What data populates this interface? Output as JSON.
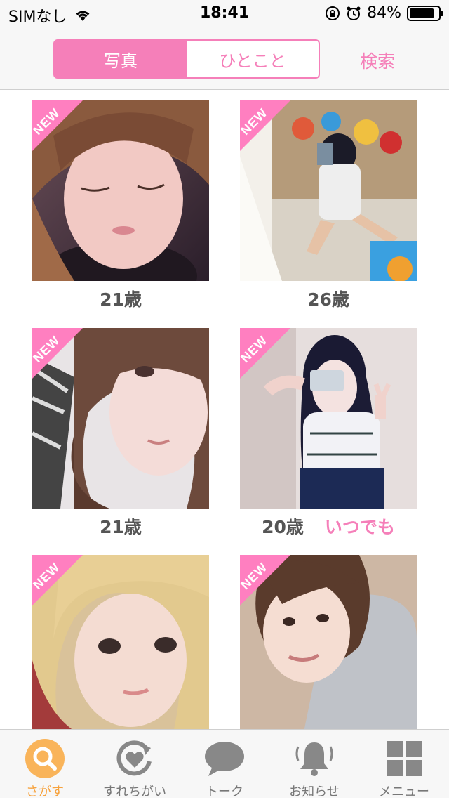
{
  "status_bar": {
    "carrier": "SIMなし",
    "time": "18:41",
    "battery": "84%",
    "battery_level": 0.84
  },
  "header": {
    "tabs": [
      {
        "label": "写真",
        "active": true
      },
      {
        "label": "ひとこと",
        "active": false
      }
    ],
    "search_label": "検索",
    "accent": "#f57fb9"
  },
  "cards": [
    {
      "badge": "NEW",
      "age": "21歳",
      "tag": ""
    },
    {
      "badge": "NEW",
      "age": "26歳",
      "tag": ""
    },
    {
      "badge": "NEW",
      "age": "21歳",
      "tag": ""
    },
    {
      "badge": "NEW",
      "age": "20歳",
      "tag": "いつでも"
    },
    {
      "badge": "NEW",
      "age": "",
      "tag": ""
    },
    {
      "badge": "NEW",
      "age": "",
      "tag": ""
    }
  ],
  "tabbar": {
    "items": [
      {
        "label": "さがす",
        "icon": "search-icon",
        "active": true
      },
      {
        "label": "すれちがい",
        "icon": "heart-refresh-icon",
        "active": false
      },
      {
        "label": "トーク",
        "icon": "speech-bubble-icon",
        "active": false
      },
      {
        "label": "お知らせ",
        "icon": "bell-icon",
        "active": false
      },
      {
        "label": "メニュー",
        "icon": "grid-menu-icon",
        "active": false
      }
    ],
    "active_color": "#f7a23c"
  }
}
